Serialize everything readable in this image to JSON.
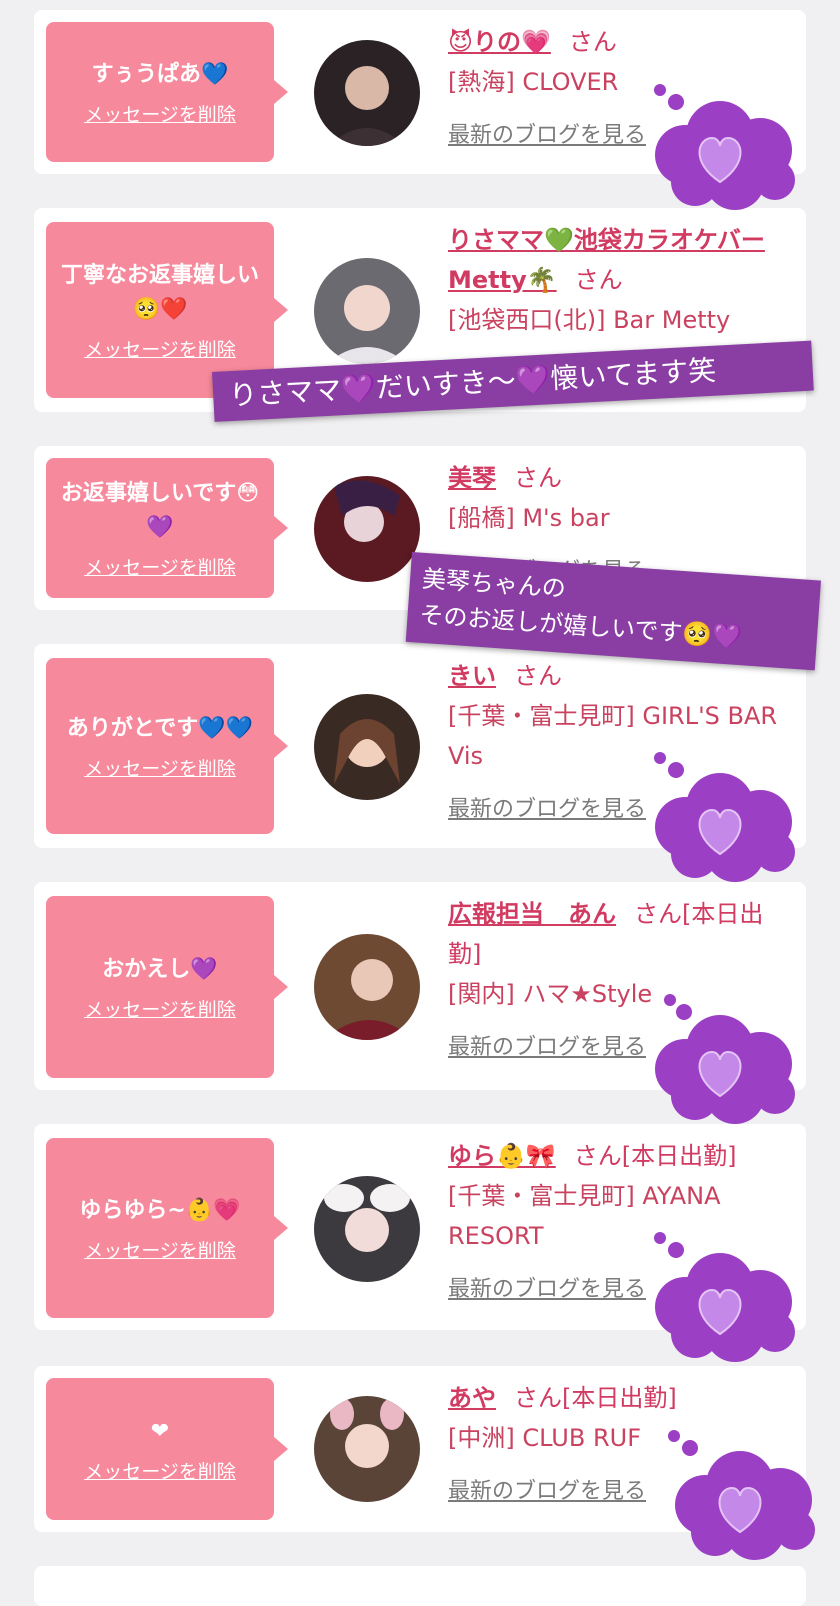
{
  "delete_label": "メッセージを削除",
  "blog_label": "最新のブログを見る",
  "san_label": "さん",
  "cards": [
    {
      "message": "すぅうぱあ💙",
      "name": "😈りの💗",
      "suffix": "",
      "shop": "[熱海] CLOVER",
      "avatar_colors": [
        "#2b2226",
        "#d9b8a8"
      ]
    },
    {
      "message": "丁寧なお返事嬉しい🥺❤️",
      "name": "りさママ💚池袋カラオケバーMetty🌴",
      "suffix": "",
      "shop": "[池袋西口(北)] Bar Metty",
      "avatar_colors": [
        "#6b6a70",
        "#f0d6cc"
      ]
    },
    {
      "message": "お返事嬉しいです😳💜",
      "name": "美琴",
      "suffix": "",
      "shop": "[船橋] M's bar",
      "avatar_colors": [
        "#5b1a22",
        "#e8d4d8"
      ]
    },
    {
      "message": "ありがとです💙💙",
      "name": "きい",
      "suffix": "",
      "shop": "[千葉・富士見町] GIRL'S BAR Vis",
      "avatar_colors": [
        "#3a2a24",
        "#f1d1bd"
      ]
    },
    {
      "message": "おかえし💜",
      "name": "広報担当　あん",
      "suffix": "[本日出勤]",
      "shop": "[関内] ハマ★Style",
      "avatar_colors": [
        "#6e4a33",
        "#e9c8b8"
      ]
    },
    {
      "message": "ゆらゆら~👶💗",
      "name": "ゆら👶🎀",
      "suffix": "[本日出勤]",
      "shop": "[千葉・富士見町] AYANA RESORT",
      "avatar_colors": [
        "#3c3a3e",
        "#f2dcd9"
      ]
    },
    {
      "message": "❤",
      "name": "あや",
      "suffix": "[本日出勤]",
      "shop": "[中洲] CLUB RUF",
      "avatar_colors": [
        "#5a4438",
        "#f3d7cc"
      ]
    }
  ],
  "overlays": {
    "banner1": "りさママ💜だいすき〜💜懐いてます笑",
    "banner2_line1": "美琴ちゃんの",
    "banner2_line2": "そのお返しが嬉しいです🥺💜"
  },
  "colors": {
    "accent": "#f7899c",
    "name": "#d13b62",
    "overlay": "#8a3ea3",
    "cloud": "#9b3fc4"
  }
}
